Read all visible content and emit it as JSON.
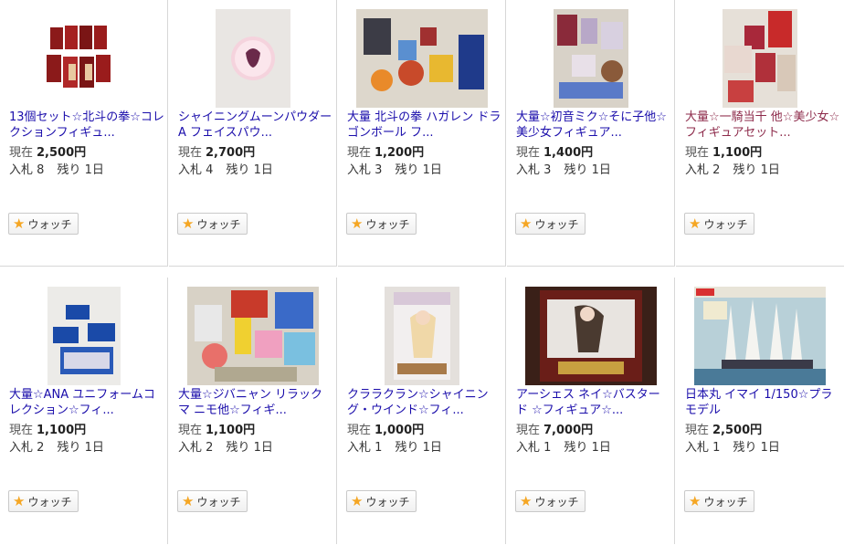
{
  "labels": {
    "current": "現在",
    "bids": "入札",
    "remaining": "残り",
    "watch": "ウォッチ"
  },
  "colors": {
    "link": "#1a0dab",
    "visited_link": "#8d2a4a",
    "watch_star": "#f5a623",
    "border": "#d7d7d7"
  },
  "items": [
    {
      "title": "13個セット☆北斗の拳☆コレクションフィギュ...",
      "price": "2,500円",
      "bids": "8",
      "remaining": "1日",
      "icon": "star-icon"
    },
    {
      "title": "シャイニングムーンパウダーA フェイスパウ...",
      "price": "2,700円",
      "bids": "4",
      "remaining": "1日",
      "icon": "star-icon"
    },
    {
      "title": "大量 北斗の拳 ハガレン ドラゴンボール フ...",
      "price": "1,200円",
      "bids": "3",
      "remaining": "1日",
      "icon": "star-icon"
    },
    {
      "title": "大量☆初音ミク☆そに子他☆美少女フィギュア...",
      "price": "1,400円",
      "bids": "3",
      "remaining": "1日",
      "icon": "star-icon"
    },
    {
      "title": "大量☆一騎当千 他☆美少女☆フィギュアセット...",
      "price": "1,100円",
      "bids": "2",
      "remaining": "1日",
      "icon": "star-icon"
    },
    {
      "title": "大量☆ANA ユニフォームコレクション☆フィ...",
      "price": "1,100円",
      "bids": "2",
      "remaining": "1日",
      "icon": "star-icon"
    },
    {
      "title": "大量☆ジバニャン リラックマ ニモ他☆フィギ...",
      "price": "1,100円",
      "bids": "2",
      "remaining": "1日",
      "icon": "star-icon"
    },
    {
      "title": "クララクラン☆シャイニング・ウインド☆フィ...",
      "price": "1,000円",
      "bids": "1",
      "remaining": "1日",
      "icon": "star-icon"
    },
    {
      "title": "アーシェス ネイ☆バスタード ☆フィギュア☆...",
      "price": "7,000円",
      "bids": "1",
      "remaining": "1日",
      "icon": "star-icon"
    },
    {
      "title": "日本丸 イマイ 1/150☆プラモデル",
      "price": "2,500円",
      "bids": "1",
      "remaining": "1日",
      "icon": "star-icon"
    }
  ]
}
